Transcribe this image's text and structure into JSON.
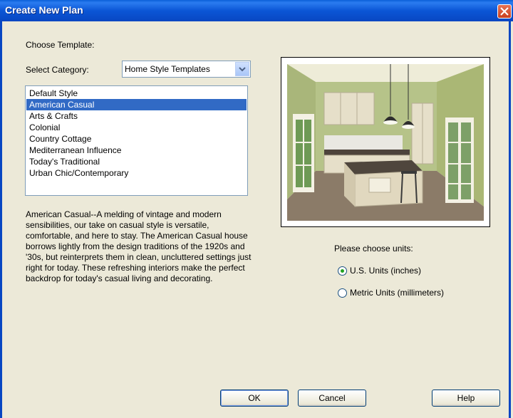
{
  "window": {
    "title": "Create New Plan"
  },
  "template": {
    "heading": "Choose Template:",
    "category_label": "Select Category:",
    "category_value": "Home Style Templates",
    "items": [
      "Default Style",
      "American Casual",
      "Arts & Crafts",
      "Colonial",
      "Country Cottage",
      "Mediterranean Influence",
      "Today's Traditional",
      "Urban Chic/Contemporary"
    ],
    "selected_index": 1,
    "description": "American Casual--A melding of vintage and modern sensibilities, our take on casual style is versatile, comfortable, and here to stay. The American Casual house borrows lightly from the design traditions of the 1920s and '30s, but reinterprets them in clean, uncluttered settings just right for today. These refreshing interiors make the perfect backdrop for today's casual living and decorating."
  },
  "units": {
    "label": "Please choose units:",
    "options": [
      {
        "label": "U.S. Units (inches)",
        "selected": true
      },
      {
        "label": "Metric Units (millimeters)",
        "selected": false
      }
    ]
  },
  "buttons": {
    "ok": "OK",
    "cancel": "Cancel",
    "help": "Help"
  },
  "icons": {
    "close": "close-icon",
    "dropdown": "chevron-down-icon"
  }
}
